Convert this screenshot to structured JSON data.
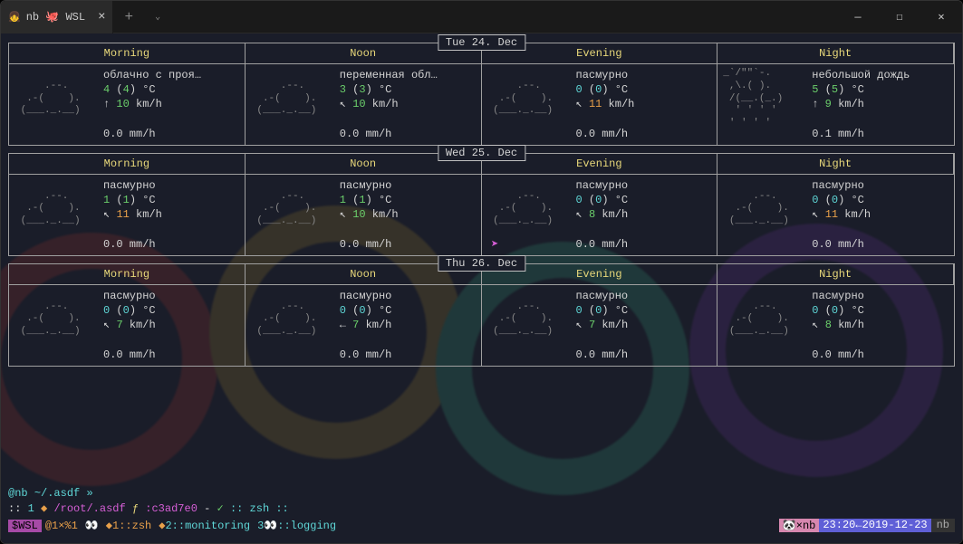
{
  "window": {
    "tab_title": "nb 🐙 WSL",
    "tab_close": "×",
    "newtab": "+",
    "dropdown": "⌄",
    "minimize": "—",
    "maximize": "☐",
    "close": "✕"
  },
  "days": [
    {
      "date": "Tue 24. Dec",
      "periods": [
        "Morning",
        "Noon",
        "Evening",
        "Night"
      ],
      "cells": [
        {
          "cond": "облачно с проя…",
          "t1": "4",
          "t2": "4",
          "wind_dir": "↑",
          "wind": "10",
          "precip": "0.0",
          "art": "cloud"
        },
        {
          "cond": "переменная обл…",
          "t1": "3",
          "t2": "3",
          "wind_dir": "↖",
          "wind": "10",
          "precip": "0.0",
          "art": "cloud"
        },
        {
          "cond": "пасмурно",
          "t1": "0",
          "t2": "0",
          "t_cyan": true,
          "wind_dir": "↖",
          "wind": "11",
          "wind_orange": true,
          "precip": "0.0",
          "art": "cloud"
        },
        {
          "cond": "небольшой дождь",
          "t1": "5",
          "t2": "5",
          "wind_dir": "↑",
          "wind": "9",
          "precip": "0.1",
          "art": "rain"
        }
      ]
    },
    {
      "date": "Wed 25. Dec",
      "periods": [
        "Morning",
        "Noon",
        "Evening",
        "Night"
      ],
      "cells": [
        {
          "cond": "пасмурно",
          "t1": "1",
          "t2": "1",
          "wind_dir": "↖",
          "wind": "11",
          "wind_orange": true,
          "precip": "0.0",
          "art": "cloud"
        },
        {
          "cond": "пасмурно",
          "t1": "1",
          "t2": "1",
          "wind_dir": "↖",
          "wind": "10",
          "precip": "0.0",
          "art": "cloud"
        },
        {
          "cond": "пасмурно",
          "t1": "0",
          "t2": "0",
          "t_cyan": true,
          "wind_dir": "↖",
          "wind": "8",
          "precip": "0.0",
          "art": "cloud"
        },
        {
          "cond": "пасмурно",
          "t1": "0",
          "t2": "0",
          "t_cyan": true,
          "wind_dir": "↖",
          "wind": "11",
          "wind_orange": true,
          "precip": "0.0",
          "art": "cloud"
        }
      ]
    },
    {
      "date": "Thu 26. Dec",
      "periods": [
        "Morning",
        "Noon",
        "Evening",
        "Night"
      ],
      "cells": [
        {
          "cond": "пасмурно",
          "t1": "0",
          "t2": "0",
          "t_cyan": true,
          "wind_dir": "↖",
          "wind": "7",
          "precip": "0.0",
          "art": "cloud"
        },
        {
          "cond": "пасмурно",
          "t1": "0",
          "t2": "0",
          "t_cyan": true,
          "wind_dir": "←",
          "wind": "7",
          "precip": "0.0",
          "art": "cloud"
        },
        {
          "cond": "пасмурно",
          "t1": "0",
          "t2": "0",
          "t_cyan": true,
          "wind_dir": "↖",
          "wind": "7",
          "precip": "0.0",
          "art": "cloud"
        },
        {
          "cond": "пасмурно",
          "t1": "0",
          "t2": "0",
          "t_cyan": true,
          "wind_dir": "↖",
          "wind": "8",
          "precip": "0.0",
          "art": "cloud"
        }
      ]
    }
  ],
  "art": {
    "cloud": "\n     .--.\n  .-(    ).\n (___._.__)\n",
    "rain": "_`/\"\"`-.\n ,\\.( ).  \n /(__.(_.)\n  ' ' ' '\n ' ' ' '"
  },
  "units": {
    "temp": "°C",
    "wind": "km/h",
    "precip": "mm/h"
  },
  "prompt": {
    "user_host": "@nb",
    "path": "~/.asdf",
    "symbol": "»"
  },
  "status": {
    "prefix": "::",
    "num": "1",
    "diamond": "◆",
    "root_path": "/root/.asdf",
    "branch_icon": "ƒ",
    "hash": ":c3ad7e0",
    "dash": "-",
    "check": "✓",
    "shell": ":: zsh ::"
  },
  "bottom": {
    "wsl": "$WSL",
    "session": "@1×%1",
    "eyes": "👀",
    "tab1": "1::zsh",
    "tab2": "2::monitoring",
    "tab3_num": "3",
    "tab3_label": "::logging",
    "host_icon": "🐼",
    "host": "×nb",
    "time": "23:20",
    "arrow": "←",
    "date_str": "2019-12-23",
    "user": "nb"
  }
}
